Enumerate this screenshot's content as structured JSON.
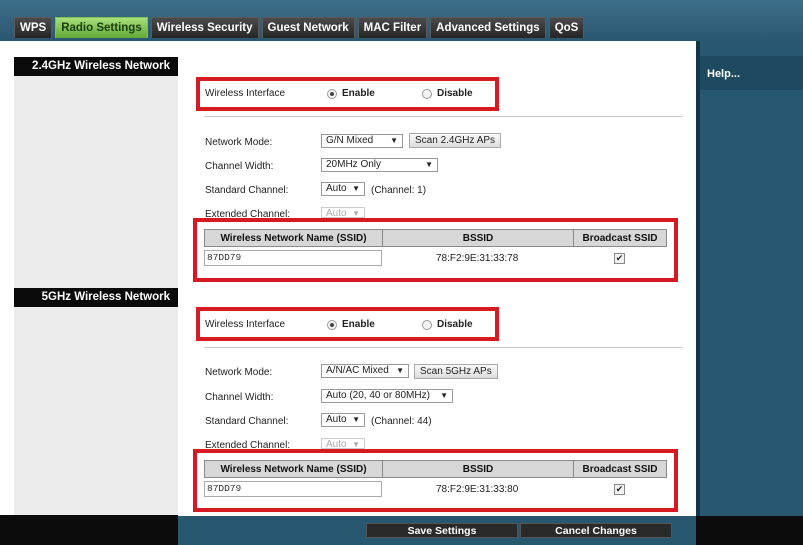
{
  "tabs": [
    "WPS",
    "Radio Settings",
    "Wireless Security",
    "Guest Network",
    "MAC Filter",
    "Advanced Settings",
    "QoS"
  ],
  "help_label": "Help...",
  "radio_24": {
    "section_title": "2.4GHz Wireless Network",
    "interface_label": "Wireless Interface",
    "enable_label": "Enable",
    "disable_label": "Disable",
    "interface_enabled": true,
    "network_mode_label": "Network Mode:",
    "network_mode_value": "G/N Mixed",
    "scan_button": "Scan 2.4GHz APs",
    "channel_width_label": "Channel Width:",
    "channel_width_value": "20MHz Only",
    "standard_channel_label": "Standard Channel:",
    "standard_channel_value": "Auto",
    "channel_note": "(Channel: 1)",
    "extended_channel_label": "Extended Channel:",
    "extended_channel_value": "Auto",
    "table_headers": [
      "Wireless Network Name (SSID)",
      "BSSID",
      "Broadcast SSID"
    ],
    "ssid": "87DD79",
    "bssid": "78:F2:9E:31:33:78",
    "broadcast": true
  },
  "radio_5": {
    "section_title": "5GHz Wireless Network",
    "interface_label": "Wireless Interface",
    "enable_label": "Enable",
    "disable_label": "Disable",
    "interface_enabled": true,
    "network_mode_label": "Network Mode:",
    "network_mode_value": "A/N/AC Mixed",
    "scan_button": "Scan 5GHz APs",
    "channel_width_label": "Channel Width:",
    "channel_width_value": "Auto (20, 40 or 80MHz)",
    "standard_channel_label": "Standard Channel:",
    "standard_channel_value": "Auto",
    "channel_note": "(Channel: 44)",
    "extended_channel_label": "Extended Channel:",
    "extended_channel_value": "Auto",
    "table_headers": [
      "Wireless Network Name (SSID)",
      "BSSID",
      "Broadcast SSID"
    ],
    "ssid": "87DD79",
    "bssid": "78:F2:9E:31:33:80",
    "broadcast": true
  },
  "actions": {
    "save": "Save Settings",
    "cancel": "Cancel Changes"
  },
  "colors": {
    "highlight_border": "#d61a22",
    "active_tab": "#62a836",
    "header_blue": "#27586f"
  }
}
